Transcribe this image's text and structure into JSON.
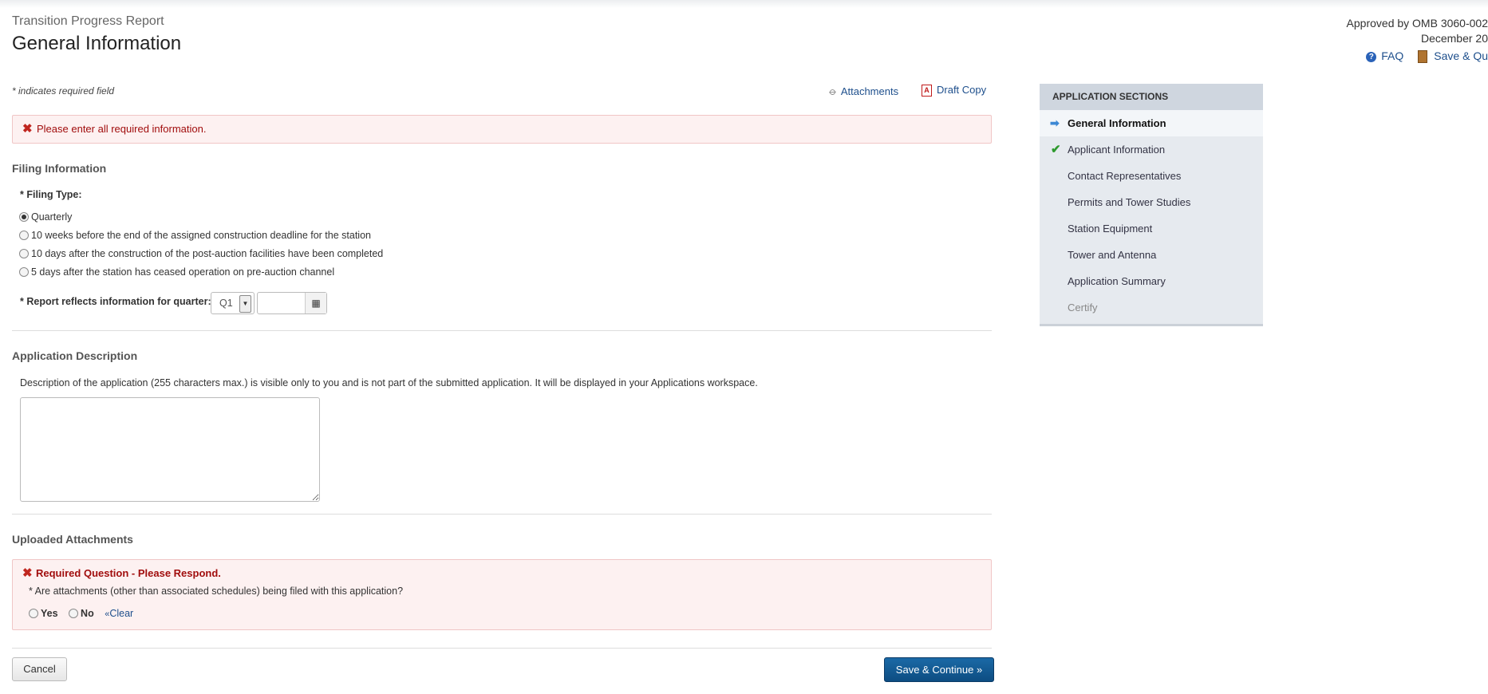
{
  "header": {
    "subtitle": "Transition Progress Report",
    "title": "General Information",
    "omb_line1": "Approved by OMB 3060-002",
    "omb_line2": "December 20",
    "faq_label": "FAQ",
    "save_quit_label": "Save & Qu"
  },
  "form": {
    "required_note": "* indicates required field",
    "attachments_link": "Attachments",
    "draft_copy_link": "Draft Copy",
    "error_message": "Please enter all required information.",
    "filing_section_title": "Filing Information",
    "filing_type_label": "* Filing Type:",
    "filing_options": [
      {
        "label": "Quarterly",
        "checked": true
      },
      {
        "label": "10 weeks before the end of the assigned construction deadline for the station",
        "checked": false
      },
      {
        "label": "10 days after the construction of the post-auction facilities have been completed",
        "checked": false
      },
      {
        "label": "5 days after the station has ceased operation on pre-auction channel",
        "checked": false
      }
    ],
    "quarter_label": "* Report reflects information for quarter:",
    "quarter_value": "Q1",
    "year_value": "",
    "app_desc_title": "Application Description",
    "app_desc_text": "Description of the application (255 characters max.) is visible only to you and is not part of the submitted application. It will be displayed in your Applications workspace.",
    "app_desc_value": "",
    "uploaded_title": "Uploaded Attachments",
    "req_question_error": "Required Question - Please Respond.",
    "attach_question": "* Are attachments (other than associated schedules) being filed with this application?",
    "yes_label": "Yes",
    "no_label": "No",
    "clear_label": "Clear",
    "cancel_label": "Cancel",
    "save_continue_label": "Save & Continue »"
  },
  "sidebar": {
    "heading": "Application Sections",
    "items": [
      {
        "label": "General Information",
        "state": "active"
      },
      {
        "label": "Applicant Information",
        "state": "complete"
      },
      {
        "label": "Contact Representatives",
        "state": "normal"
      },
      {
        "label": "Permits and Tower Studies",
        "state": "normal"
      },
      {
        "label": "Station Equipment",
        "state": "normal"
      },
      {
        "label": "Tower and Antenna",
        "state": "normal"
      },
      {
        "label": "Application Summary",
        "state": "normal"
      },
      {
        "label": "Certify",
        "state": "disabled"
      }
    ]
  }
}
